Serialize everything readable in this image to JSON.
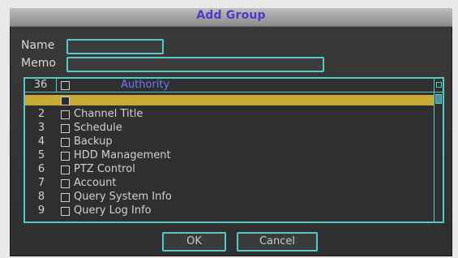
{
  "dialog": {
    "title": "Add Group",
    "fields": {
      "name_label": "Name",
      "name_value": "",
      "memo_label": "Memo",
      "memo_value": ""
    },
    "list": {
      "header": {
        "count": "36",
        "label": "Authority"
      },
      "rows": [
        {
          "num": "",
          "label": "",
          "checked": true,
          "selected": true
        },
        {
          "num": "2",
          "label": "Channel Title",
          "checked": false,
          "selected": false
        },
        {
          "num": "3",
          "label": "Schedule",
          "checked": false,
          "selected": false
        },
        {
          "num": "4",
          "label": "Backup",
          "checked": false,
          "selected": false
        },
        {
          "num": "5",
          "label": "HDD Management",
          "checked": false,
          "selected": false
        },
        {
          "num": "6",
          "label": "PTZ Control",
          "checked": false,
          "selected": false
        },
        {
          "num": "7",
          "label": "Account",
          "checked": false,
          "selected": false
        },
        {
          "num": "8",
          "label": "Query System Info",
          "checked": false,
          "selected": false
        },
        {
          "num": "9",
          "label": "Query Log Info",
          "checked": false,
          "selected": false
        }
      ]
    },
    "buttons": {
      "ok": "OK",
      "cancel": "Cancel"
    }
  },
  "colors": {
    "accent": "#57c9c7",
    "selected_row": "#c8a934",
    "title_text": "#4b3cc9",
    "header_text": "#6b79ff"
  },
  "icons": {
    "checkbox": "checkbox-icon",
    "scroll_up": "scroll-up-icon"
  }
}
